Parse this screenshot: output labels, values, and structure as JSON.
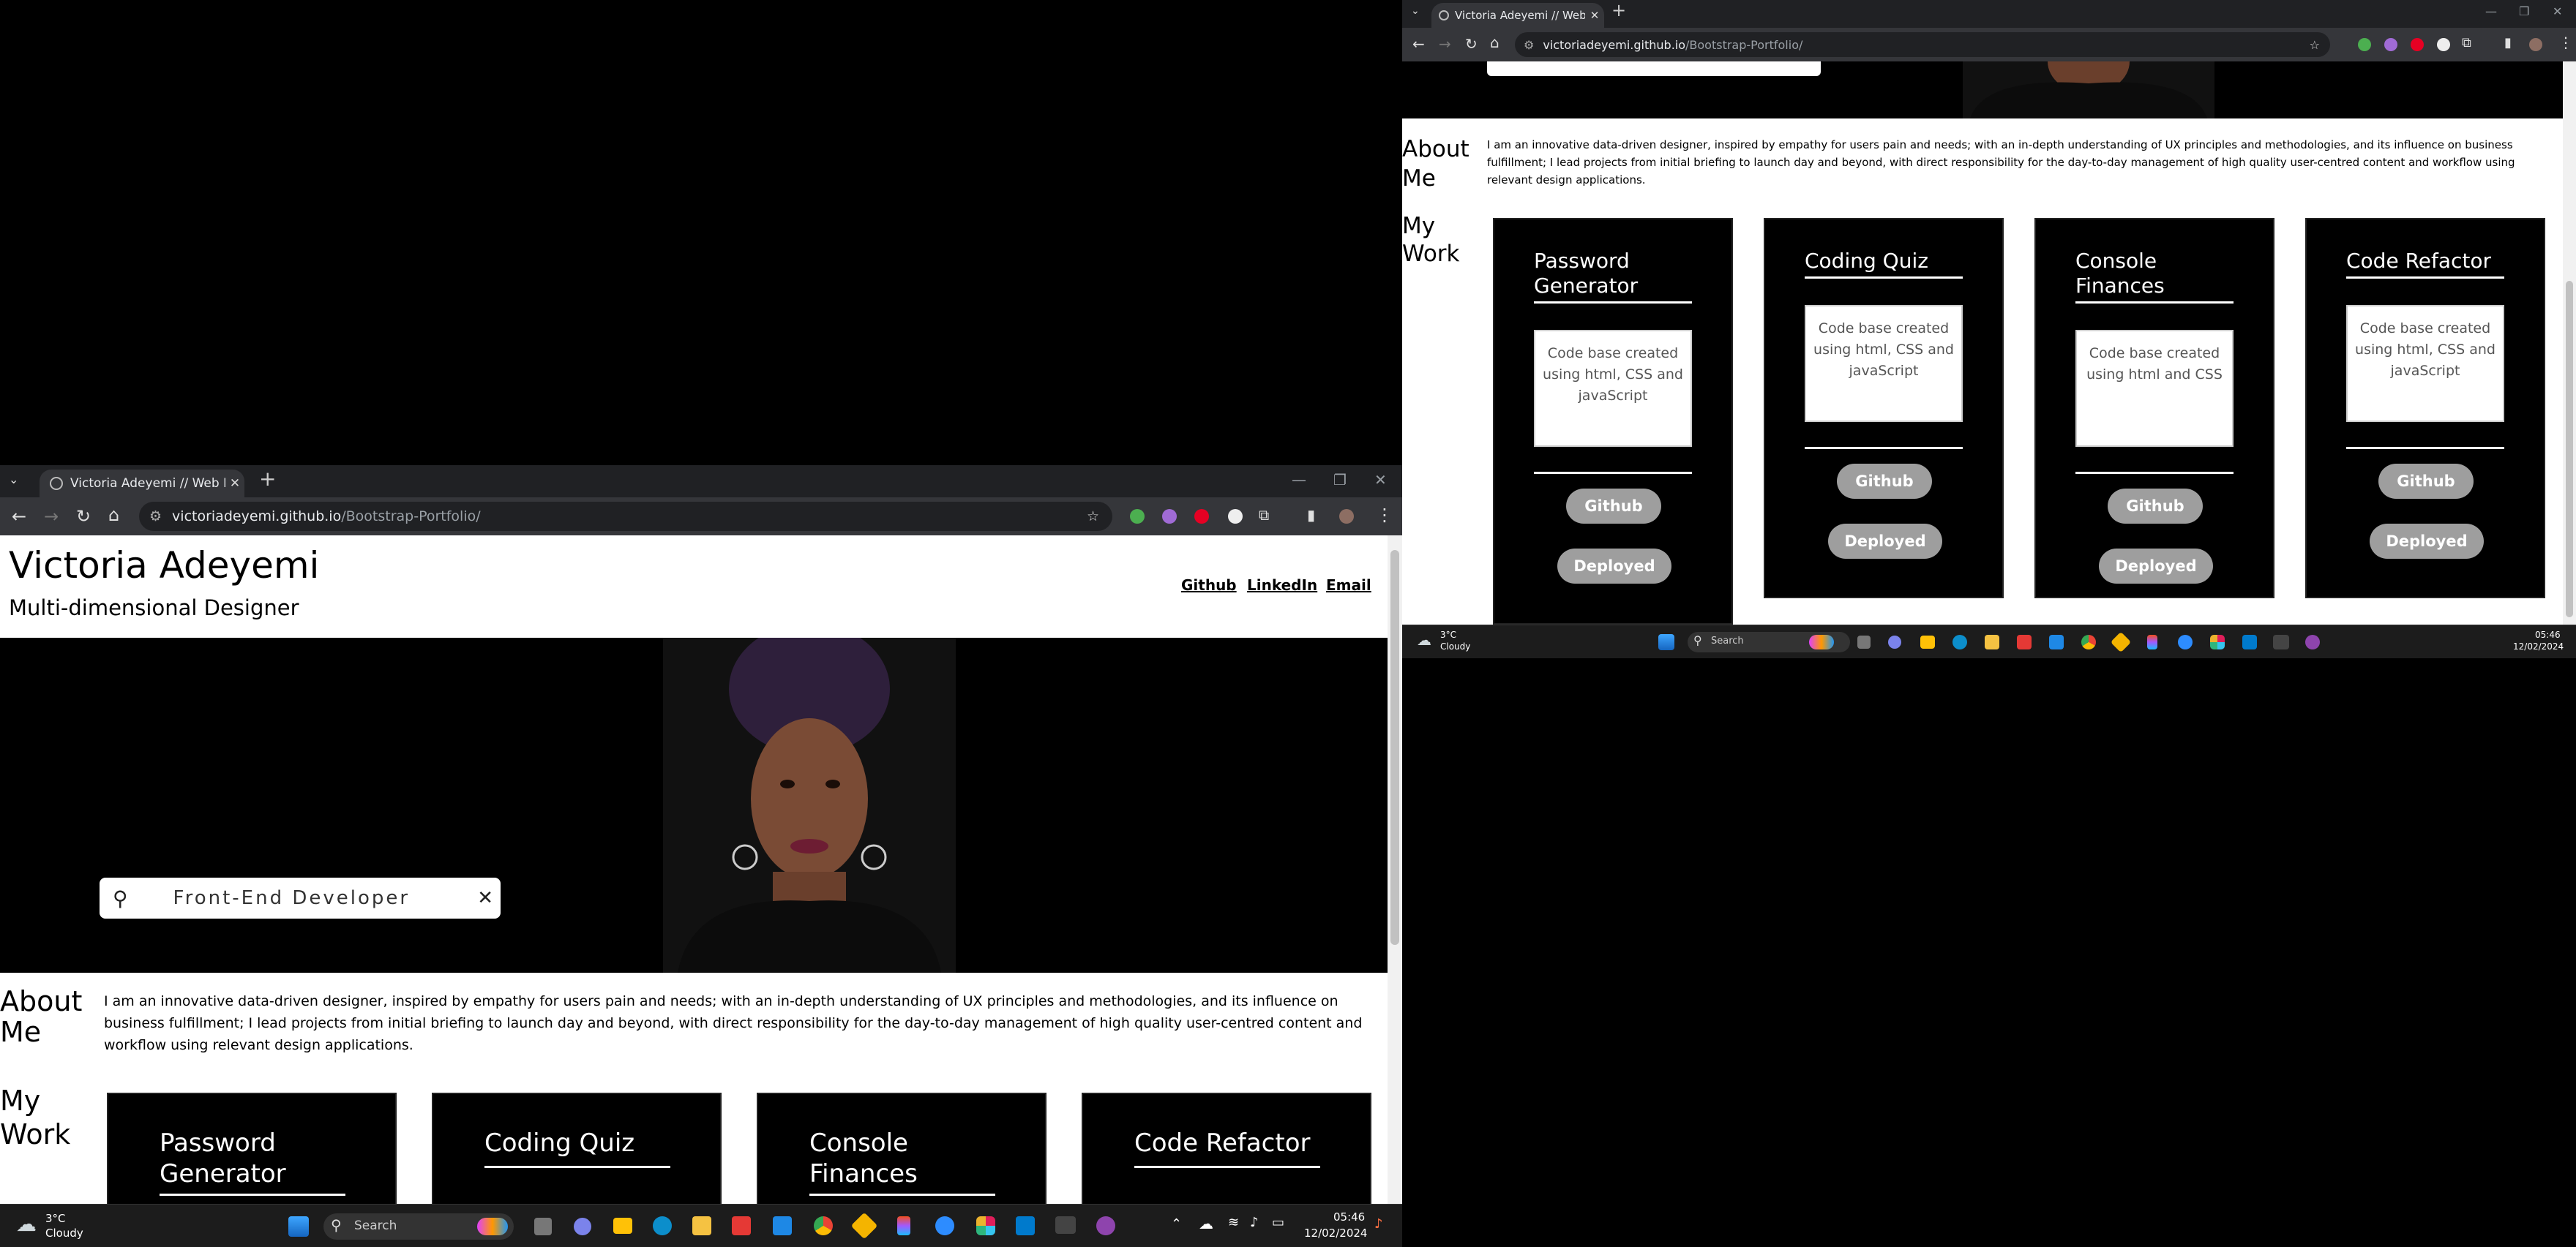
{
  "browser_left": {
    "tab_title": "Victoria Adeyemi // Web Devel",
    "url_host": "victoriadeyemi.github.io",
    "url_path": "/Bootstrap-Portfolio/"
  },
  "browser_right": {
    "tab_title": "Victoria Adeyemi // Web Devel",
    "url_host": "victoriadeyemi.github.io",
    "url_path": "/Bootstrap-Portfolio/"
  },
  "portfolio": {
    "name": "Victoria Adeyemi",
    "tagline": "Multi-dimensional Designer",
    "nav": [
      "Github",
      "LinkedIn",
      "Email"
    ],
    "search_value": "Front-End Developer",
    "about_heading_1": "About",
    "about_heading_2": "Me",
    "about_text": "I am an innovative data-driven designer, inspired by empathy for users pain and needs; with an in-depth understanding of UX principles and methodologies, and its influence on business fulfillment; I lead projects from initial briefing to launch day and beyond, with direct responsibility for the day-to-day management of high quality user-centred content and workflow using relevant design applications.",
    "work_heading_1": "My",
    "work_heading_2": "Work",
    "projects": [
      {
        "title_1": "Password",
        "title_2": "Generator",
        "desc": "Code base created using html, CSS and javaScript",
        "github": "Github",
        "deployed": "Deployed"
      },
      {
        "title_1": "Coding Quiz",
        "title_2": "",
        "desc": "Code base created using html, CSS and javaScript",
        "github": "Github",
        "deployed": "Deployed"
      },
      {
        "title_1": "Console Finances",
        "title_2": "",
        "desc": "Code base created using html and CSS",
        "github": "Github",
        "deployed": "Deployed"
      },
      {
        "title_1": "Code Refactor",
        "title_2": "",
        "desc": "Code base created using html, CSS and javaScript",
        "github": "Github",
        "deployed": "Deployed"
      }
    ],
    "left_titles": [
      {
        "title_1": "Password",
        "title_2": "Generator"
      },
      {
        "title_1": "Coding Quiz",
        "title_2": ""
      },
      {
        "title_1": "Console",
        "title_2": "Finances"
      },
      {
        "title_1": "Code Refactor",
        "title_2": ""
      }
    ]
  },
  "taskbar_left": {
    "weather_temp": "3°C",
    "weather_desc": "Cloudy",
    "search": "Search",
    "time": "05:46",
    "date": "12/02/2024"
  },
  "taskbar_right": {
    "weather_temp": "3°C",
    "weather_desc": "Cloudy",
    "search": "Search",
    "time": "05:46",
    "date": "12/02/2024"
  },
  "colors": {
    "chrome_dark": "#202124",
    "toolbar": "#35363a",
    "pill": "#9e9e9e",
    "taskbar": "#1c1c1c"
  }
}
